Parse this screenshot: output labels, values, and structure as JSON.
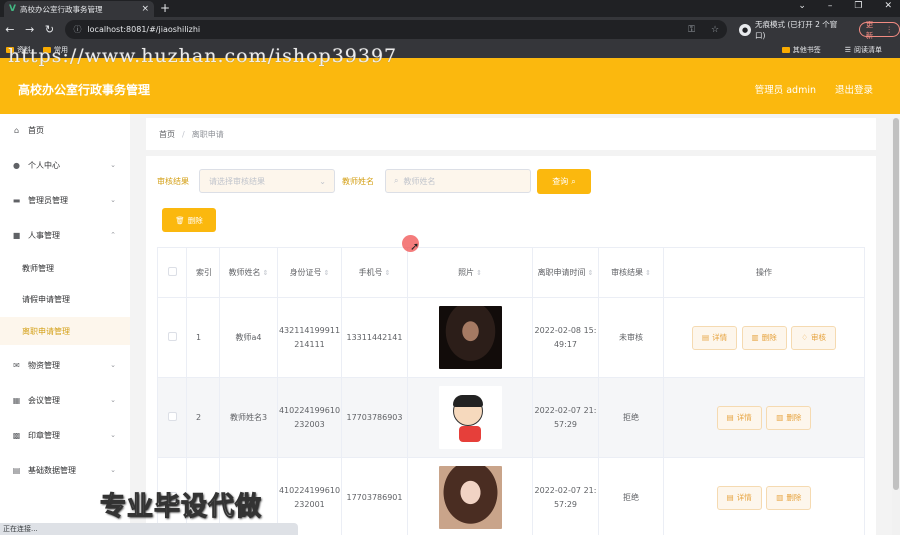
{
  "browser": {
    "tab_title": "高校办公室行政事务管理",
    "url": "localhost:8081/#/jiaoshilizhi",
    "incognito_label": "无痕模式 (已打开 2 个窗口)",
    "update_label": "更新",
    "bookmarks": [
      "资料",
      "常用"
    ],
    "bookmarks_right": [
      "其他书签",
      "阅读清单"
    ],
    "status_text": "正在连接..."
  },
  "watermark": "https://www.huzhan.com/ishop39397",
  "overlay_text": "专业毕设代做",
  "header": {
    "title": "高校办公室行政事务管理",
    "admin_label": "管理员 admin",
    "logout_label": "退出登录"
  },
  "sidebar": {
    "items": [
      {
        "label": "首页",
        "icon": "home-icon"
      },
      {
        "label": "个人中心",
        "icon": "user-icon"
      },
      {
        "label": "管理员管理",
        "icon": "briefcase-icon"
      },
      {
        "label": "人事管理",
        "icon": "folder-icon"
      }
    ],
    "sub_items": [
      "教师管理",
      "请假申请管理",
      "离职申请管理"
    ],
    "items_after": [
      {
        "label": "物资管理",
        "icon": "mail-icon"
      },
      {
        "label": "会议管理",
        "icon": "grid-icon"
      },
      {
        "label": "印章管理",
        "icon": "stamp-icon"
      },
      {
        "label": "基础数据管理",
        "icon": "clipboard-icon"
      }
    ]
  },
  "breadcrumb": {
    "home": "首页",
    "current": "离职申请"
  },
  "filters": {
    "review_label": "审核结果",
    "review_placeholder": "请选择审核结果",
    "name_label": "教师姓名",
    "name_placeholder": "教师姓名",
    "query_label": "查询"
  },
  "delete_label": "删除",
  "table": {
    "headers": [
      "索引",
      "教师姓名",
      "身份证号",
      "手机号",
      "照片",
      "离职申请时间",
      "审核结果",
      "操作"
    ],
    "action_labels": {
      "detail": "详情",
      "delete": "删除",
      "review": "审核"
    },
    "rows": [
      {
        "index": "1",
        "name": "教师a4",
        "id_card": "432114199911214111",
        "phone": "13311442141",
        "photo": "man",
        "time": "2022-02-08 15:49:17",
        "result": "未审核"
      },
      {
        "index": "2",
        "name": "教师姓名3",
        "id_card": "410224199610232003",
        "phone": "17703786903",
        "photo": "cartoon",
        "time": "2022-02-07 21:57:29",
        "result": "拒绝"
      },
      {
        "index": "",
        "name": "",
        "id_card": "410224199610232001",
        "phone": "17703786901",
        "photo": "girl",
        "time": "2022-02-07 21:57:29",
        "result": "拒绝"
      }
    ]
  }
}
